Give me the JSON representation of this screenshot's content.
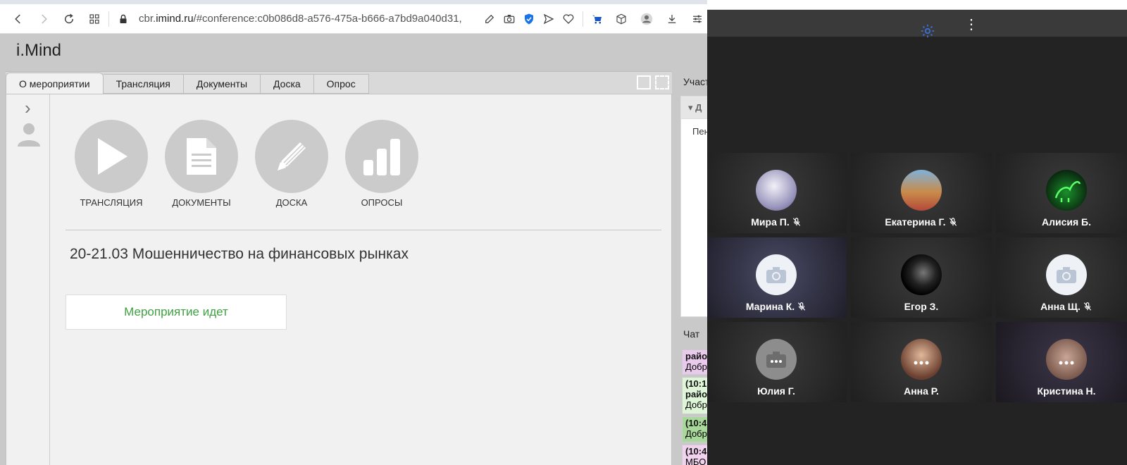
{
  "browser": {
    "url_prefix": "cbr.",
    "url_host": "imind.ru",
    "url_rest": "/#conference:c0b086d8-a576-475a-b666-a7bd9a040d31,",
    "icons": [
      "back-icon",
      "forward-icon",
      "reload-icon",
      "apps-grid-icon",
      "lock-icon",
      "edit-icon",
      "camera-icon",
      "shield-icon",
      "send-icon",
      "heart-icon",
      "cart-icon",
      "cube-icon",
      "profile-icon",
      "download-icon",
      "settings-sliders-icon"
    ]
  },
  "app": {
    "logo": "i.Mind",
    "tabs": [
      "О мероприятии",
      "Трансляция",
      "Документы",
      "Доска",
      "Опрос"
    ],
    "active_tab": 0,
    "tiles": [
      {
        "label": "ТРАНСЛЯЦИЯ",
        "icon": "play-icon"
      },
      {
        "label": "ДОКУМЕНТЫ",
        "icon": "document-icon"
      },
      {
        "label": "ДОСКА",
        "icon": "pencil-icon"
      },
      {
        "label": "ОПРОСЫ",
        "icon": "bar-chart-icon"
      }
    ],
    "event_title": "20-21.03 Мошенничество на финансовых рынках",
    "event_status": "Мероприятие идет",
    "participants_label": "Участ",
    "participants_header": "Д",
    "participant_row": "Пен",
    "chat_label": "Чат",
    "chat_messages": [
      {
        "line1": "район",
        "line2": "Добр",
        "color": "#e9c9ec"
      },
      {
        "line1": "(10:1",
        "line2": "район",
        "line3": "Добр",
        "color": "#def5d8"
      },
      {
        "line1": "(10:4",
        "line2": "Добр",
        "color": "#a9d89b"
      },
      {
        "line1": "(10:4",
        "line2": "МБО",
        "color": "#f1d3ef"
      }
    ]
  },
  "video": {
    "participants": [
      {
        "name": "Мира П.",
        "muted": true,
        "avatar": "anime-girl"
      },
      {
        "name": "Екатерина Г.",
        "muted": true,
        "avatar": "photo-child"
      },
      {
        "name": "Алисия Б.",
        "muted": false,
        "avatar": "green-dino"
      },
      {
        "name": "Марина К.",
        "muted": true,
        "avatar": "camera-placeholder"
      },
      {
        "name": "Егор З.",
        "muted": false,
        "avatar": "bw-drawing"
      },
      {
        "name": "Анна Щ.",
        "muted": true,
        "avatar": "camera-placeholder"
      },
      {
        "name": "Юлия Г.",
        "muted": false,
        "avatar": "camera-placeholder-dark"
      },
      {
        "name": "Анна Р.",
        "muted": false,
        "avatar": "photo-girl"
      },
      {
        "name": "Кристина Н.",
        "muted": false,
        "avatar": "anime-brown"
      }
    ]
  }
}
